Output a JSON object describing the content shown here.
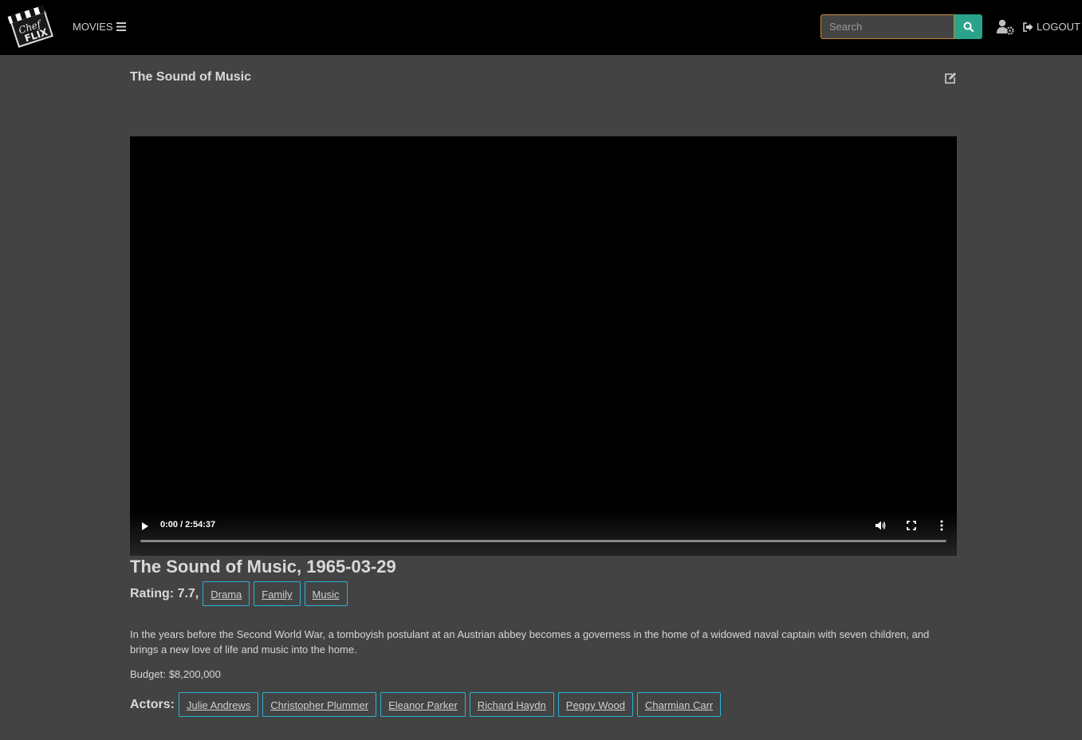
{
  "nav": {
    "movies_label": "MOVIES",
    "logout_label": "LOGOUT",
    "search_placeholder": "Search"
  },
  "page": {
    "title": "The Sound of Music"
  },
  "video": {
    "time_display": "0:00 / 2:54:37",
    "progress": 0
  },
  "movie": {
    "title": "The Sound of Music,",
    "release_date": "1965-03-29",
    "rating_label": "Rating:",
    "rating_value": "7.7,",
    "genres": [
      "Drama",
      "Family",
      "Music"
    ],
    "overview": "In the years before the Second World War, a tomboyish postulant at an Austrian abbey becomes a governess in the home of a widowed naval captain with seven children, and brings a new love of life and music into the home.",
    "budget_label": "Budget:",
    "budget_value": "$8,200,000",
    "actors_label": "Actors:",
    "actors": [
      "Julie Andrews",
      "Christopher Plummer",
      "Eleanor Parker",
      "Richard Haydn",
      "Peggy Wood",
      "Charmian Carr"
    ]
  },
  "colors": {
    "background": "#434343",
    "navbar": "#000000",
    "search_accent": "#2aa38b",
    "search_border": "#c9873b",
    "tag_border": "#2bb3d4"
  },
  "icons": {
    "logo": "clapperboard-logo",
    "menu": "bars-icon",
    "search": "search-icon",
    "user_settings": "user-cog-icon",
    "logout": "sign-out-icon",
    "edit": "edit-icon"
  }
}
